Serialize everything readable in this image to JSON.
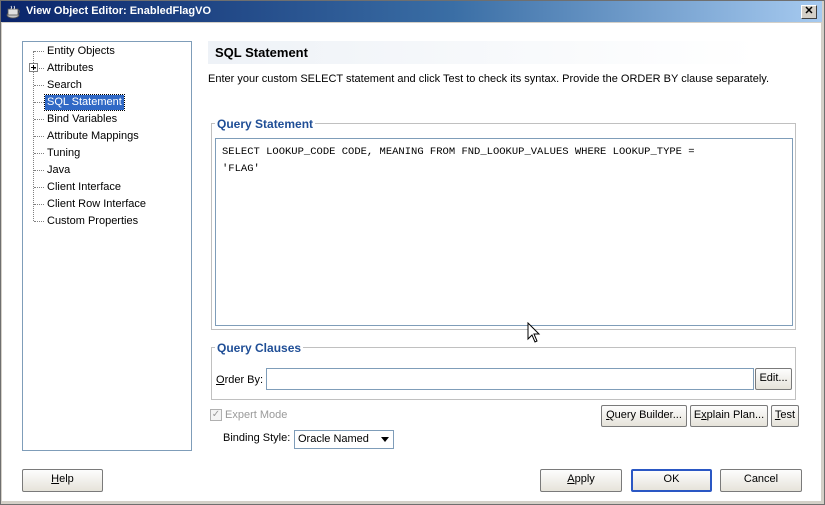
{
  "window": {
    "title": "View Object Editor: EnabledFlagVO",
    "close_glyph": "✕"
  },
  "nav": {
    "items": [
      {
        "label": "Entity Objects",
        "selected": false
      },
      {
        "label": "Attributes",
        "selected": false,
        "expandable": true
      },
      {
        "label": "Search",
        "selected": false
      },
      {
        "label": "SQL Statement",
        "selected": true
      },
      {
        "label": "Bind Variables",
        "selected": false
      },
      {
        "label": "Attribute Mappings",
        "selected": false
      },
      {
        "label": "Tuning",
        "selected": false
      },
      {
        "label": "Java",
        "selected": false
      },
      {
        "label": "Client Interface",
        "selected": false
      },
      {
        "label": "Client Row Interface",
        "selected": false
      },
      {
        "label": "Custom Properties",
        "selected": false
      }
    ]
  },
  "main": {
    "title": "SQL Statement",
    "instructions": "Enter your custom SELECT statement and click Test to check its syntax.  Provide the ORDER BY clause separately.",
    "query_statement": {
      "label": "Query Statement",
      "value": "SELECT LOOKUP_CODE CODE, MEANING FROM FND_LOOKUP_VALUES WHERE LOOKUP_TYPE =\n'FLAG'"
    },
    "query_clauses": {
      "label": "Query Clauses",
      "order_by_label_pre": "",
      "order_by_label_u": "O",
      "order_by_label_post": "rder By:",
      "order_by_value": "",
      "edit_label": "Edit..."
    },
    "expert_mode": {
      "label": "Expert Mode",
      "checked": true,
      "enabled": false
    },
    "binding_style": {
      "label": "Binding Style:",
      "value": "Oracle Named"
    },
    "buttons": {
      "query_builder_pre": "",
      "query_builder_u": "Q",
      "query_builder_post": "uery Builder...",
      "explain_plan_pre": "E",
      "explain_plan_u": "x",
      "explain_plan_post": "plain Plan...",
      "test_pre": "",
      "test_u": "T",
      "test_post": "est"
    }
  },
  "footer": {
    "help_u": "H",
    "help_post": "elp",
    "apply_u": "A",
    "apply_post": "pply",
    "ok_label": "OK",
    "cancel_label": "Cancel"
  },
  "colors": {
    "title_bar_start": "#0a246a",
    "selection": "#3169c6",
    "group_label": "#1f4e96",
    "default_button_border": "#2a57c4"
  }
}
